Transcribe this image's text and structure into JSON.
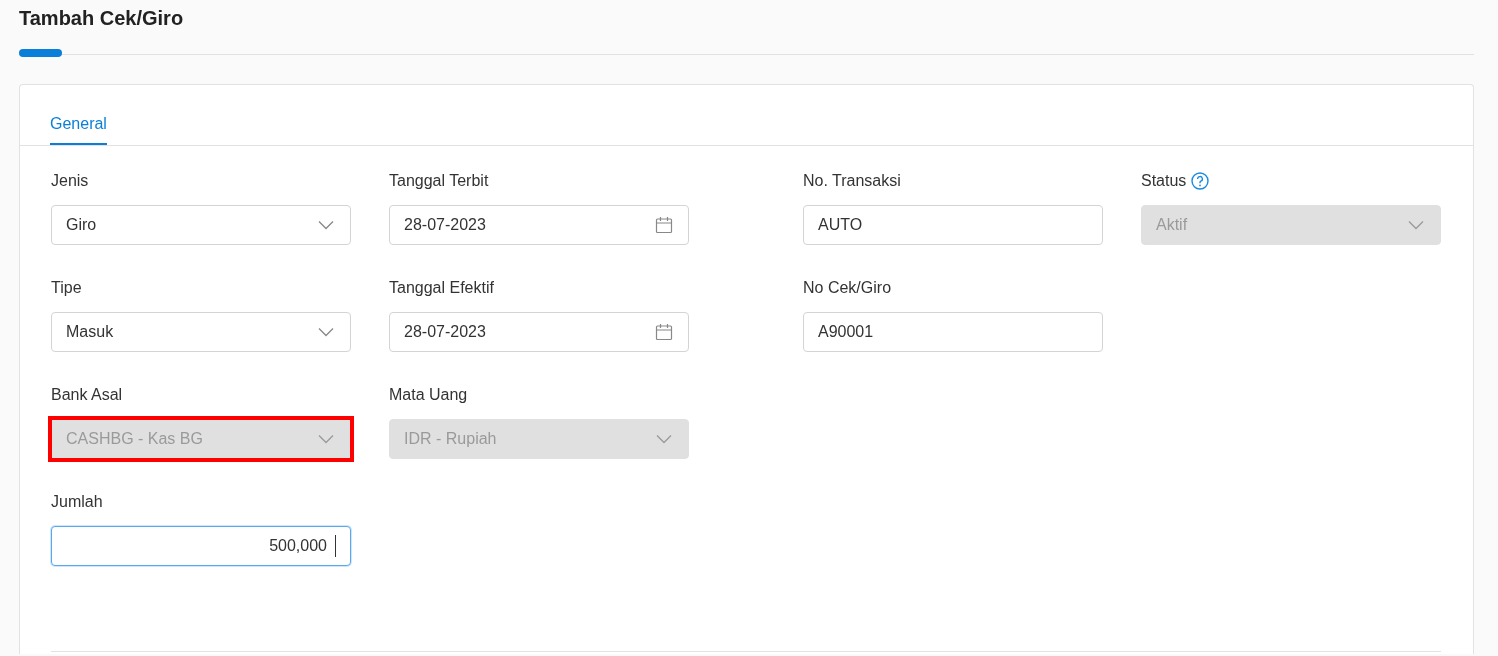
{
  "page": {
    "title": "Tambah Cek/Giro"
  },
  "tabs": [
    {
      "label": "General",
      "selected": true
    }
  ],
  "form_rows": [
    [
      {
        "label": "Jenis",
        "kind": "select",
        "value": "Giro",
        "disabled": false,
        "help": false,
        "focused": false,
        "highlighted": false
      },
      {
        "label": "Tanggal Terbit",
        "kind": "date",
        "value": "28-07-2023",
        "disabled": false,
        "help": false,
        "focused": false,
        "highlighted": false
      },
      {
        "label": "No. Transaksi",
        "kind": "text",
        "value": "AUTO",
        "disabled": false,
        "help": false,
        "focused": false,
        "highlighted": false
      },
      {
        "label": "Status",
        "kind": "select",
        "value": "Aktif",
        "disabled": true,
        "help": true,
        "focused": false,
        "highlighted": false
      }
    ],
    [
      {
        "label": "Tipe",
        "kind": "select",
        "value": "Masuk",
        "disabled": false,
        "help": false,
        "focused": false,
        "highlighted": false
      },
      {
        "label": "Tanggal Efektif",
        "kind": "date",
        "value": "28-07-2023",
        "disabled": false,
        "help": false,
        "focused": false,
        "highlighted": false
      },
      {
        "label": "No Cek/Giro",
        "kind": "text",
        "value": "A90001",
        "disabled": false,
        "help": false,
        "focused": false,
        "highlighted": false
      }
    ],
    [
      {
        "label": "Bank Asal",
        "kind": "select",
        "value": "CASHBG - Kas BG",
        "disabled": true,
        "help": false,
        "focused": false,
        "highlighted": true
      },
      {
        "label": "Mata Uang",
        "kind": "select",
        "value": "IDR - Rupiah",
        "disabled": true,
        "help": false,
        "focused": false,
        "highlighted": false
      }
    ],
    [
      {
        "label": "Jumlah",
        "kind": "number",
        "value": "500,000",
        "disabled": false,
        "help": false,
        "focused": true,
        "highlighted": false
      }
    ]
  ]
}
